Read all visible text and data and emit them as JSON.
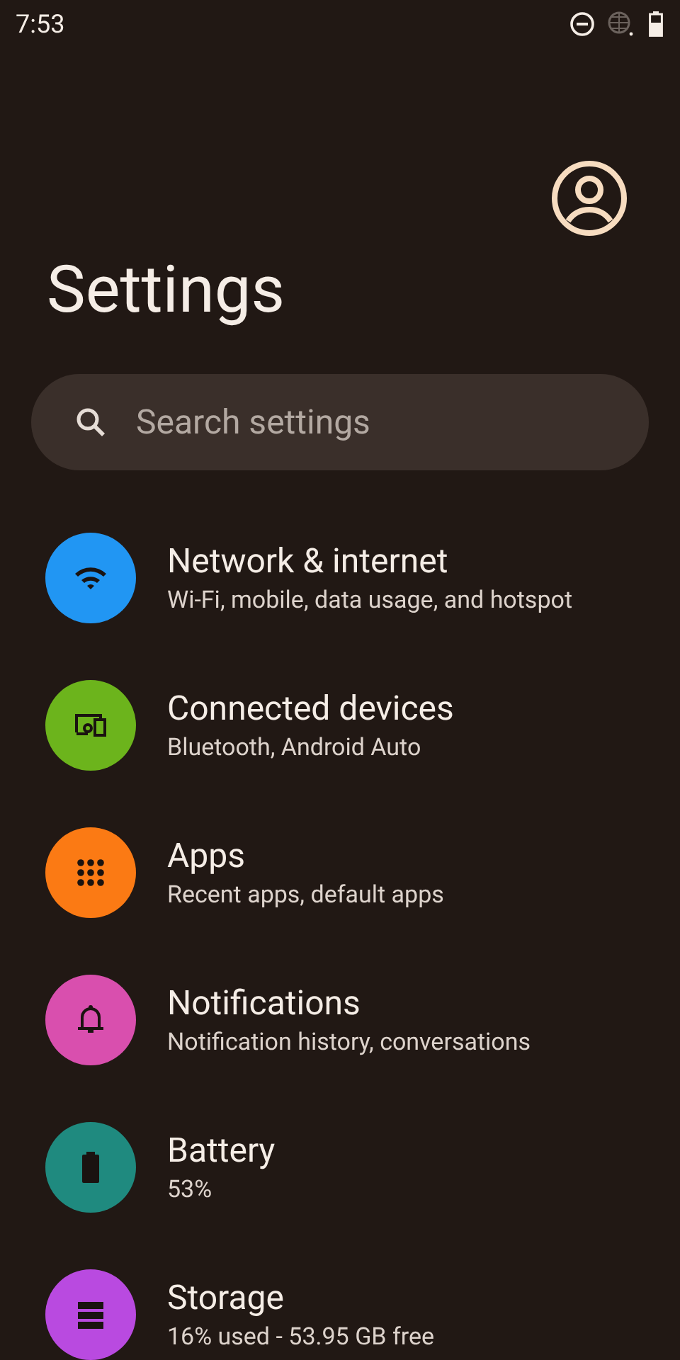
{
  "status_bar": {
    "time": "7:53"
  },
  "title": "Settings",
  "search": {
    "placeholder": "Search settings"
  },
  "items": [
    {
      "kind": "wifi",
      "color": "#2196f3",
      "title": "Network & internet",
      "subtitle": "Wi-Fi, mobile, data usage, and hotspot"
    },
    {
      "kind": "devices",
      "color": "#6cb41c",
      "title": "Connected devices",
      "subtitle": "Bluetooth, Android Auto"
    },
    {
      "kind": "apps",
      "color": "#fb7a14",
      "title": "Apps",
      "subtitle": "Recent apps, default apps"
    },
    {
      "kind": "bell",
      "color": "#d94fae",
      "title": "Notifications",
      "subtitle": "Notification history, conversations"
    },
    {
      "kind": "battery",
      "color": "#1f8a7f",
      "title": "Battery",
      "subtitle": "53%"
    },
    {
      "kind": "storage",
      "color": "#b94ae0",
      "title": "Storage",
      "subtitle": "16% used - 53.95 GB free"
    }
  ]
}
